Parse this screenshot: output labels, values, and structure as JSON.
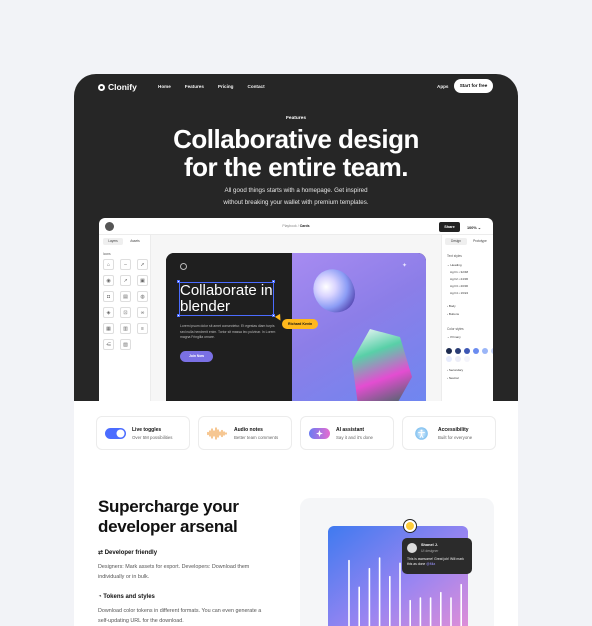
{
  "brand": {
    "name": "Clonify"
  },
  "nav": {
    "links": [
      "Home",
      "Features",
      "Pricing",
      "Contact"
    ],
    "apps": "Apps",
    "cta": "Start for free"
  },
  "hero": {
    "eyebrow": "Features",
    "title_line1": "Collaborative design",
    "title_line2": "for the entire team.",
    "sub_line1": "All good things starts with a homepage. Get inspired",
    "sub_line2": "without breaking your wallet with premium templates."
  },
  "app": {
    "breadcrumb_prefix": "Playbook / ",
    "breadcrumb_current": "Cards",
    "share": "Share",
    "zoom": "100%",
    "left_tabs": [
      "Layers",
      "Assets"
    ],
    "icons_label": "Icons",
    "right_tabs": [
      "Design",
      "Prototype"
    ],
    "text_styles_label": "Text styles",
    "heading_label": "Heading",
    "heading_items": [
      "Ag h1 • 32/48",
      "Ag h2 • 24/36",
      "Ag h3 • 20/30",
      "Ag h4 • 16/24"
    ],
    "body_label": "Body",
    "buttons_label": "Buttons",
    "color_styles_label": "Color styles",
    "primary_label": "Primary",
    "secondary_label": "Secondary",
    "neutral_label": "Neutral",
    "swatches": [
      "#1d2b4f",
      "#2a3d75",
      "#3d57b5",
      "#6b8cf0",
      "#9bb6f8",
      "#c9d6fb",
      "#e6ebfd",
      "#ecedf8",
      "#f4f4fb"
    ],
    "design_card": {
      "title_line1": "Collaborate in",
      "title_line2": "blender",
      "body": "Lorem ipsum dolor sit amet consectetur. Et egestas diam turpis sed nulla hendrerit enim. Tortor sit massa leo pulvinar. In Lorem magna Fringilla ornare.",
      "button": "Join Now",
      "cursor_name": "Richard Kevin"
    }
  },
  "features": [
    {
      "title": "Live toggles",
      "desc": "Over 5M possibilities",
      "icon": "toggle-icon"
    },
    {
      "title": "Audio notes",
      "desc": "Better team comments",
      "icon": "waveform-icon"
    },
    {
      "title": "AI assistant",
      "desc": "Say it and it's done",
      "icon": "sparkle-icon"
    },
    {
      "title": "Accessibility",
      "desc": "Built for everyone",
      "icon": "accessibility-icon"
    }
  ],
  "developer": {
    "title_line1": "Supercharge your",
    "title_line2": "developer arsenal",
    "point1_title": "Developer friendly",
    "point1_desc": "Designers: Mark assets for export. Developers: Download them individually or in bulk.",
    "point2_title": "Tokens and styles",
    "point2_desc": "Download color tokens in different formats. You can even generate a self-updating URL for the download."
  },
  "tooltip": {
    "name": "Shonel J.",
    "handle": "UI designer",
    "message": "This is awesome! Great job! Will mark this as done",
    "message_link": "@Mia"
  },
  "chart_data": {
    "type": "bar",
    "values": [
      58,
      38,
      52,
      60,
      46,
      56,
      28,
      30,
      30,
      34,
      30,
      40
    ]
  }
}
